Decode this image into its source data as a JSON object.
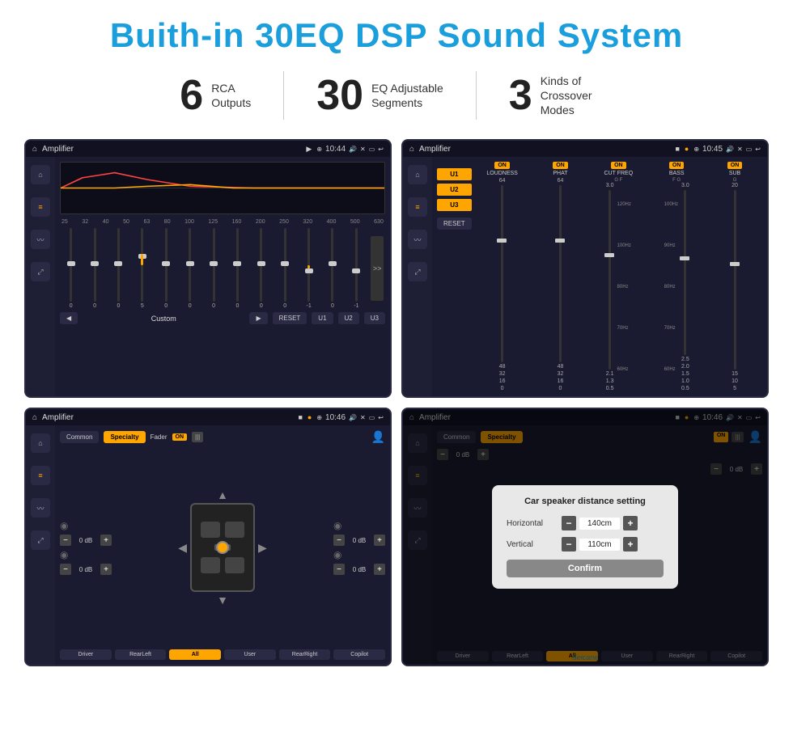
{
  "header": {
    "title": "Buith-in 30EQ DSP Sound System"
  },
  "stats": [
    {
      "number": "6",
      "label": "RCA\nOutputs"
    },
    {
      "number": "30",
      "label": "EQ Adjustable\nSegments"
    },
    {
      "number": "3",
      "label": "Kinds of\nCrossover Modes"
    }
  ],
  "screens": {
    "eq": {
      "title": "Amplifier",
      "time": "10:44",
      "freq_labels": [
        "25",
        "32",
        "40",
        "50",
        "63",
        "80",
        "100",
        "125",
        "160",
        "200",
        "250",
        "320",
        "400",
        "500",
        "630"
      ],
      "slider_values": [
        "0",
        "0",
        "0",
        "5",
        "0",
        "0",
        "0",
        "0",
        "0",
        "0",
        "-1",
        "0",
        "-1"
      ],
      "bottom_buttons": [
        "◀",
        "Custom",
        "▶",
        "RESET",
        "U1",
        "U2",
        "U3"
      ]
    },
    "amplifier": {
      "title": "Amplifier",
      "time": "10:45",
      "channels": [
        "LOUDNESS",
        "PHAT",
        "CUT FREQ",
        "BASS",
        "SUB"
      ],
      "channel_sublabels": [
        "",
        "",
        "G  F",
        "F  G",
        "G"
      ],
      "reset_label": "RESET",
      "u_buttons": [
        "U1",
        "U2",
        "U3"
      ]
    },
    "fader": {
      "title": "Amplifier",
      "time": "10:46",
      "tabs": [
        "Common",
        "Specialty"
      ],
      "fader_label": "Fader",
      "on_badge": "ON",
      "db_values": [
        "0 dB",
        "0 dB",
        "0 dB",
        "0 dB"
      ],
      "bottom_buttons": [
        "Driver",
        "RearLeft",
        "All",
        "User",
        "RearRight",
        "Copilot"
      ]
    },
    "distance": {
      "title": "Amplifier",
      "time": "10:46",
      "tabs": [
        "Common",
        "Specialty"
      ],
      "on_badge": "ON",
      "dialog": {
        "title": "Car speaker distance setting",
        "horizontal_label": "Horizontal",
        "horizontal_value": "140cm",
        "vertical_label": "Vertical",
        "vertical_value": "110cm",
        "confirm_label": "Confirm"
      },
      "bottom_buttons": [
        "Driver",
        "RearLeft",
        "All",
        "User",
        "RearRight",
        "Copilot"
      ],
      "db_values": [
        "0 dB",
        "0 dB"
      ]
    }
  },
  "watermark": "Seicane"
}
